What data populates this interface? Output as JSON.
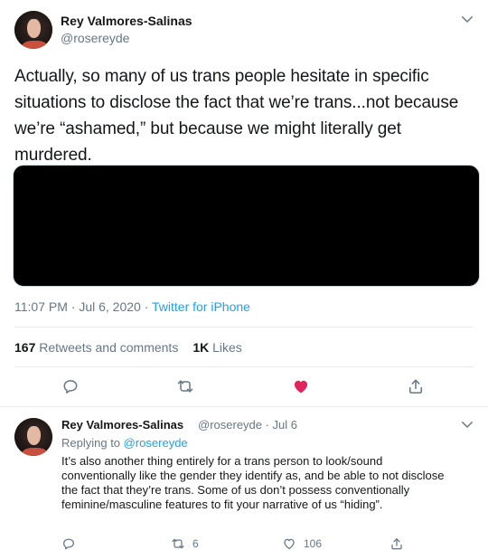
{
  "main_tweet": {
    "author_name": "Rey Valmores-Salinas",
    "author_handle": "@rosereyde",
    "text": "Actually, so many of us trans people hesitate in specific situations to disclose the fact that we’re trans...not because we’re “ashamed,” but because we might literally get murdered.",
    "time": "11:07 PM · Jul 6, 2020 · ",
    "source": "Twitter for iPhone",
    "retweets_count": "167",
    "retweets_label": "Retweets and comments",
    "likes_count": "1K",
    "likes_label": "Likes"
  },
  "reply_tweet": {
    "author_name": "Rey Valmores-Salinas",
    "handle_and_date": "@rosereyde · Jul 6",
    "replying_prefix": "Replying to ",
    "replying_to": "@rosereyde",
    "text": "It’s also another thing entirely for a trans person to look/sound conventionally like the gender they identify as, and be able to not disclose the fact that they’re trans. Some of us don’t possess conventionally feminine/masculine features to fit your narrative of us “hiding”.",
    "retweet_count": "6",
    "like_count": "106"
  },
  "colors": {
    "accent": "#1da1f2",
    "like_red": "#e0245e",
    "muted": "#657786",
    "text": "#14171a"
  }
}
